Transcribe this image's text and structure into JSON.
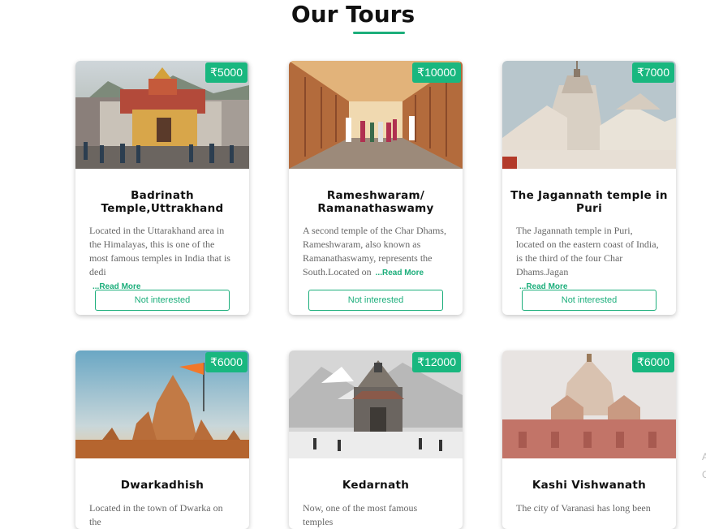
{
  "section": {
    "title": "Our Tours"
  },
  "tours": [
    {
      "price": "₹5000",
      "title": "Badrinath Temple,Uttrakhand",
      "description": "Located in the Uttarakhand area in the Himalayas, this is one of the most famous temples in India that is dedi",
      "read_more": "...Read More",
      "button": "Not interested"
    },
    {
      "price": "₹10000",
      "title": "Rameshwaram/ Ramanathaswamy",
      "description": "A second temple of the Char Dhams, Rameshwaram, also known as Ramanathaswamy, represents the South.Located on",
      "read_more": "...Read More",
      "button": "Not interested"
    },
    {
      "price": "₹7000",
      "title": "The Jagannath temple in Puri",
      "description": "The Jagannath temple in Puri, located on the eastern coast of India, is the third of the four Char Dhams.Jagan",
      "read_more": "...Read More",
      "button": "Not interested"
    },
    {
      "price": "₹6000",
      "title": "Dwarkadhish",
      "description": "Located in the town of Dwarka on the"
    },
    {
      "price": "₹12000",
      "title": "Kedarnath",
      "description": "Now, one of the most famous temples"
    },
    {
      "price": "₹6000",
      "title": "Kashi Vishwanath",
      "description": "The city of Varanasi has long been"
    }
  ],
  "edge_glyphs": [
    "A",
    "G"
  ]
}
